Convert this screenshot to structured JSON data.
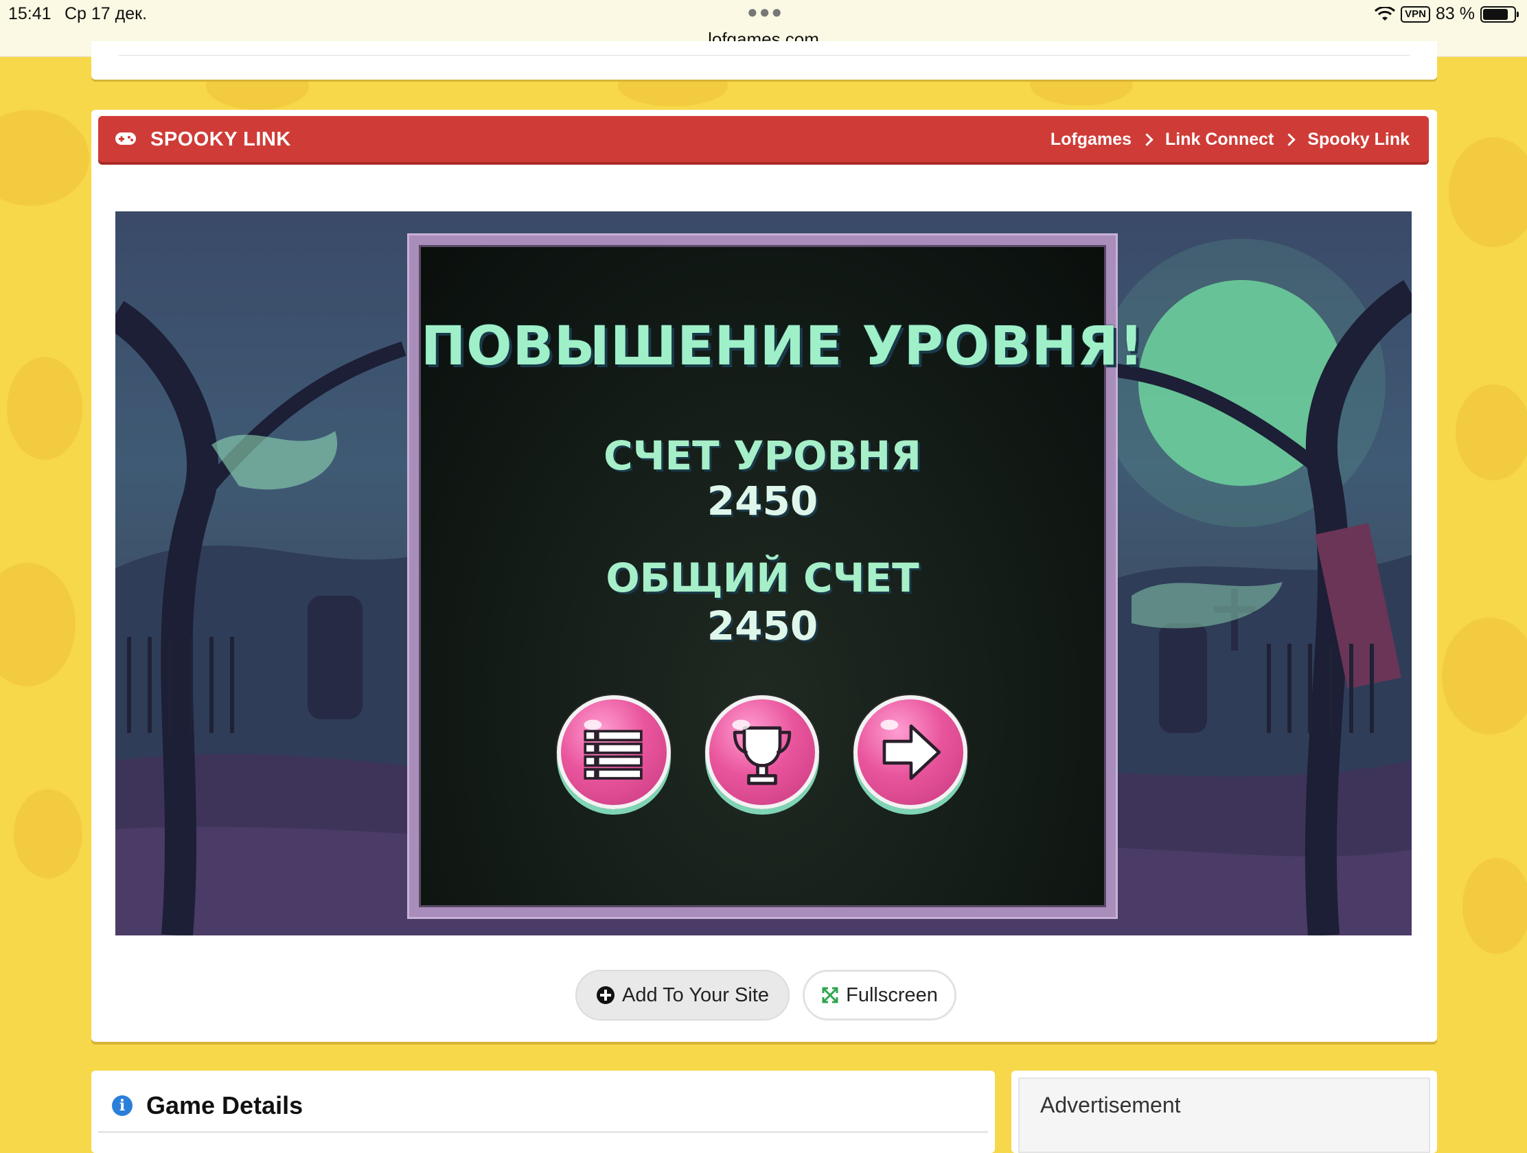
{
  "status_bar": {
    "time": "15:41",
    "date": "Ср 17 дек.",
    "url": "lofgames.com",
    "vpn": "VPN",
    "battery": "83 %"
  },
  "header": {
    "game_title": "SPOOKY LINK",
    "breadcrumb": [
      "Lofgames",
      "Link Connect",
      "Spooky Link"
    ]
  },
  "game": {
    "heading": "ПОВЫШЕНИЕ УРОВНЯ!",
    "level_score_label": "СЧЕТ УРОВНЯ",
    "level_score": "2450",
    "total_score_label": "ОБЩИЙ СЧЕТ",
    "total_score": "2450",
    "buttons": [
      "menu-icon",
      "trophy-icon",
      "next-arrow-icon"
    ]
  },
  "actions": {
    "add_label": "Add To Your Site",
    "fullscreen_label": "Fullscreen"
  },
  "details": {
    "title": "Game Details"
  },
  "ad": {
    "title": "Advertisement"
  },
  "colors": {
    "page_bg": "#f7d84a",
    "title_bar": "#cf3c37",
    "score_text": "#a6efc9",
    "button_pink": "#e9559d"
  }
}
